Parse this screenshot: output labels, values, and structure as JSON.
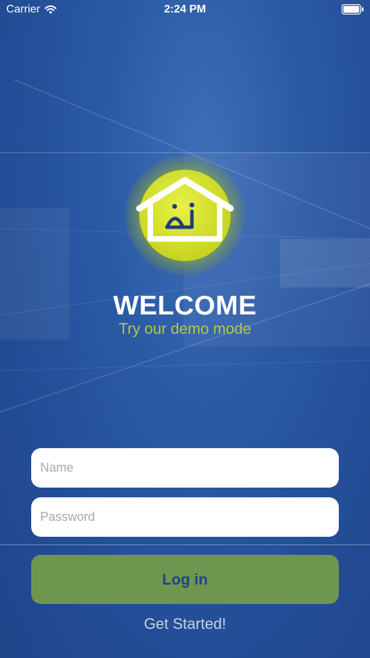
{
  "status_bar": {
    "carrier": "Carrier",
    "time": "2:24 PM",
    "wifi_icon": "wifi-icon",
    "battery_icon": "battery-icon"
  },
  "logo": {
    "icon": "home-icon",
    "accent_color": "#d4e02a",
    "mark_color": "#1e3e7a"
  },
  "welcome": {
    "title": "WELCOME",
    "demo_link": "Try our demo mode"
  },
  "form": {
    "name_placeholder": "Name",
    "password_placeholder": "Password",
    "login_label": "Log in",
    "get_started_label": "Get Started!"
  },
  "colors": {
    "background": "#2b5aa5",
    "demo_text": "#b4c941",
    "login_button": "#6f964f",
    "login_text": "#1e4486"
  }
}
